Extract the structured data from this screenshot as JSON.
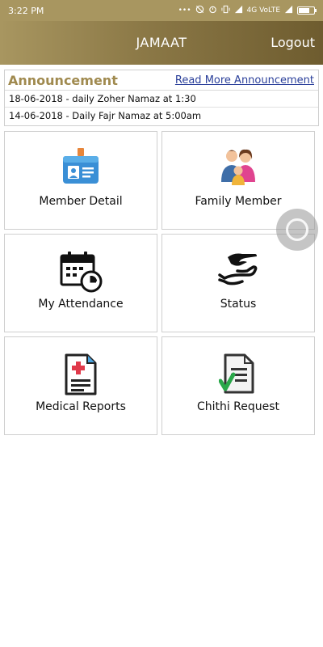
{
  "status_bar": {
    "time": "3:22 PM",
    "indicators": "4G VoLTE",
    "icons": [
      "dots-icon",
      "mute-icon",
      "alarm-icon",
      "vibrate-icon",
      "signal-icon",
      "battery-icon"
    ]
  },
  "app_bar": {
    "title": "JAMAAT",
    "logout_label": "Logout"
  },
  "announcement": {
    "title": "Announcement",
    "read_more_label": "Read More Announcement",
    "items": [
      "18-06-2018 - daily Zoher Namaz at 1:30",
      "14-06-2018 - Daily Fajr Namaz at 5:00am"
    ]
  },
  "tiles": [
    {
      "label": "Member Detail",
      "icon": "id-card-icon"
    },
    {
      "label": "Family Member",
      "icon": "family-icon"
    },
    {
      "label": "My Attendance",
      "icon": "calendar-clock-icon"
    },
    {
      "label": "Status",
      "icon": "hand-icon"
    },
    {
      "label": "Medical Reports",
      "icon": "medical-report-icon"
    },
    {
      "label": "Chithi Request",
      "icon": "document-check-icon"
    }
  ],
  "colors": {
    "app_bar_start": "#a89660",
    "app_bar_end": "#6e5c2f",
    "announcement_title": "#a08a4f",
    "link": "#2a3f9a"
  }
}
